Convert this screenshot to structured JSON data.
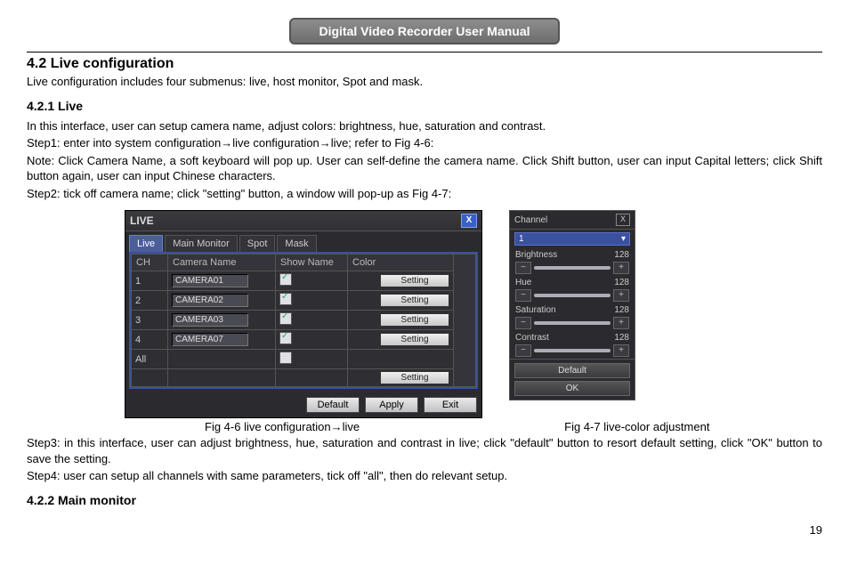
{
  "header": "Digital Video Recorder User Manual",
  "section_num": "4.2",
  "section_title": "Live configuration",
  "intro": "Live configuration includes four submenus: live, host monitor, Spot and mask.",
  "sub1_num": "4.2.1",
  "sub1_title": "Live",
  "p1": "In this interface, user can setup camera name, adjust colors: brightness, hue, saturation and contrast.",
  "p2": "Step1: enter into system configuration→live configuration→live; refer to Fig 4-6:",
  "p3": "Note: Click Camera Name, a soft keyboard will pop up. User can self-define the camera name. Click Shift button, user can input Capital letters; click Shift button again, user can input Chinese characters.",
  "p4": "Step2: tick off camera name; click \"setting\" button, a window will pop-up as Fig 4-7:",
  "fig1_caption": "Fig 4-6 live configuration→live",
  "fig2_caption": "Fig 4-7 live-color adjustment",
  "p5": "Step3: in this interface, user can adjust brightness, hue, saturation and contrast in live; click \"default\" button to resort default setting, click \"OK\" button to save the setting.",
  "p6": "Step4: user can setup all channels with same parameters, tick off \"all\", then do relevant setup.",
  "sub2_num": "4.2.2",
  "sub2_title": "Main monitor",
  "page_number": "19",
  "win1": {
    "title": "LIVE",
    "close": "X",
    "tabs": [
      "Live",
      "Main Monitor",
      "Spot",
      "Mask"
    ],
    "headers": [
      "CH",
      "Camera Name",
      "Show Name",
      "Color"
    ],
    "rows": [
      {
        "ch": "1",
        "name": "CAMERA01",
        "btn": "Setting"
      },
      {
        "ch": "2",
        "name": "CAMERA02",
        "btn": "Setting"
      },
      {
        "ch": "3",
        "name": "CAMERA03",
        "btn": "Setting"
      },
      {
        "ch": "4",
        "name": "CAMERA07",
        "btn": "Setting"
      }
    ],
    "all_label": "All",
    "all_btn": "Setting",
    "buttons": [
      "Default",
      "Apply",
      "Exit"
    ]
  },
  "win2": {
    "channel_label": "Channel",
    "close": "X",
    "channel_value": "1",
    "dropdown_icon": "▾",
    "sliders": [
      {
        "label": "Brightness",
        "value": "128"
      },
      {
        "label": "Hue",
        "value": "128"
      },
      {
        "label": "Saturation",
        "value": "128"
      },
      {
        "label": "Contrast",
        "value": "128"
      }
    ],
    "minus": "−",
    "plus": "+",
    "default_btn": "Default",
    "ok_btn": "OK"
  }
}
